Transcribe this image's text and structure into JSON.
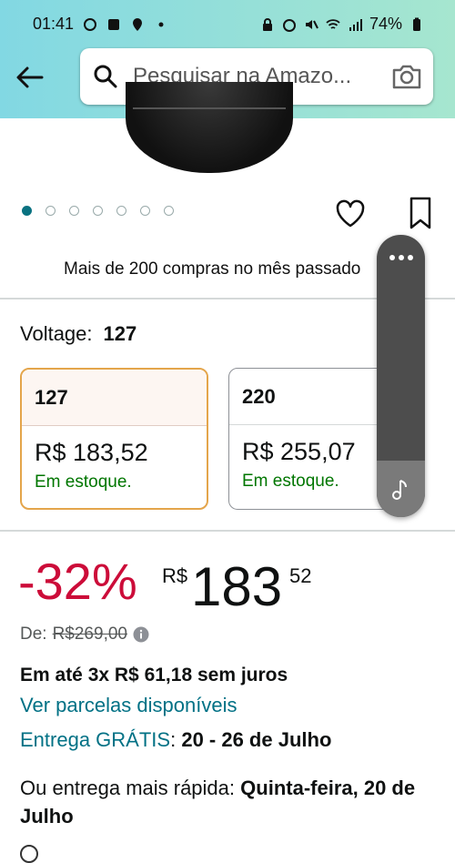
{
  "status_bar": {
    "time": "01:41",
    "battery": "74%"
  },
  "header": {
    "search_placeholder": "Pesquisar na Amazo..."
  },
  "gallery": {
    "dot_count": 7,
    "active_index": 0
  },
  "purchases_text": "Mais de 200 compras no mês passado",
  "variation": {
    "label": "Voltage:",
    "selected": "127",
    "options": [
      {
        "name": "127",
        "price": "R$ 183,52",
        "stock": "Em estoque."
      },
      {
        "name": "220",
        "price": "R$ 255,07",
        "stock": "Em estoque."
      }
    ]
  },
  "pricing": {
    "discount": "-32%",
    "currency": "R$",
    "whole": "183",
    "cents": "52",
    "list_label": "De:",
    "list_price": "R$269,00",
    "installments": "Em até 3x R$ 61,18 sem juros",
    "installments_link": "Ver parcelas disponíveis"
  },
  "delivery": {
    "free_label": "Entrega GRÁTIS",
    "sep": ":",
    "range": "20 - 26 de Julho",
    "faster_prefix": "Ou entrega mais rápida:",
    "faster_date": "Quinta-feira, 20 de Julho"
  },
  "colors": {
    "header_gradient_start": "#82d8e3",
    "header_gradient_end": "#a6e6cf",
    "link": "#007185",
    "discount": "#cc0c39",
    "in_stock": "#007600",
    "selected_border": "#e4a54b"
  }
}
